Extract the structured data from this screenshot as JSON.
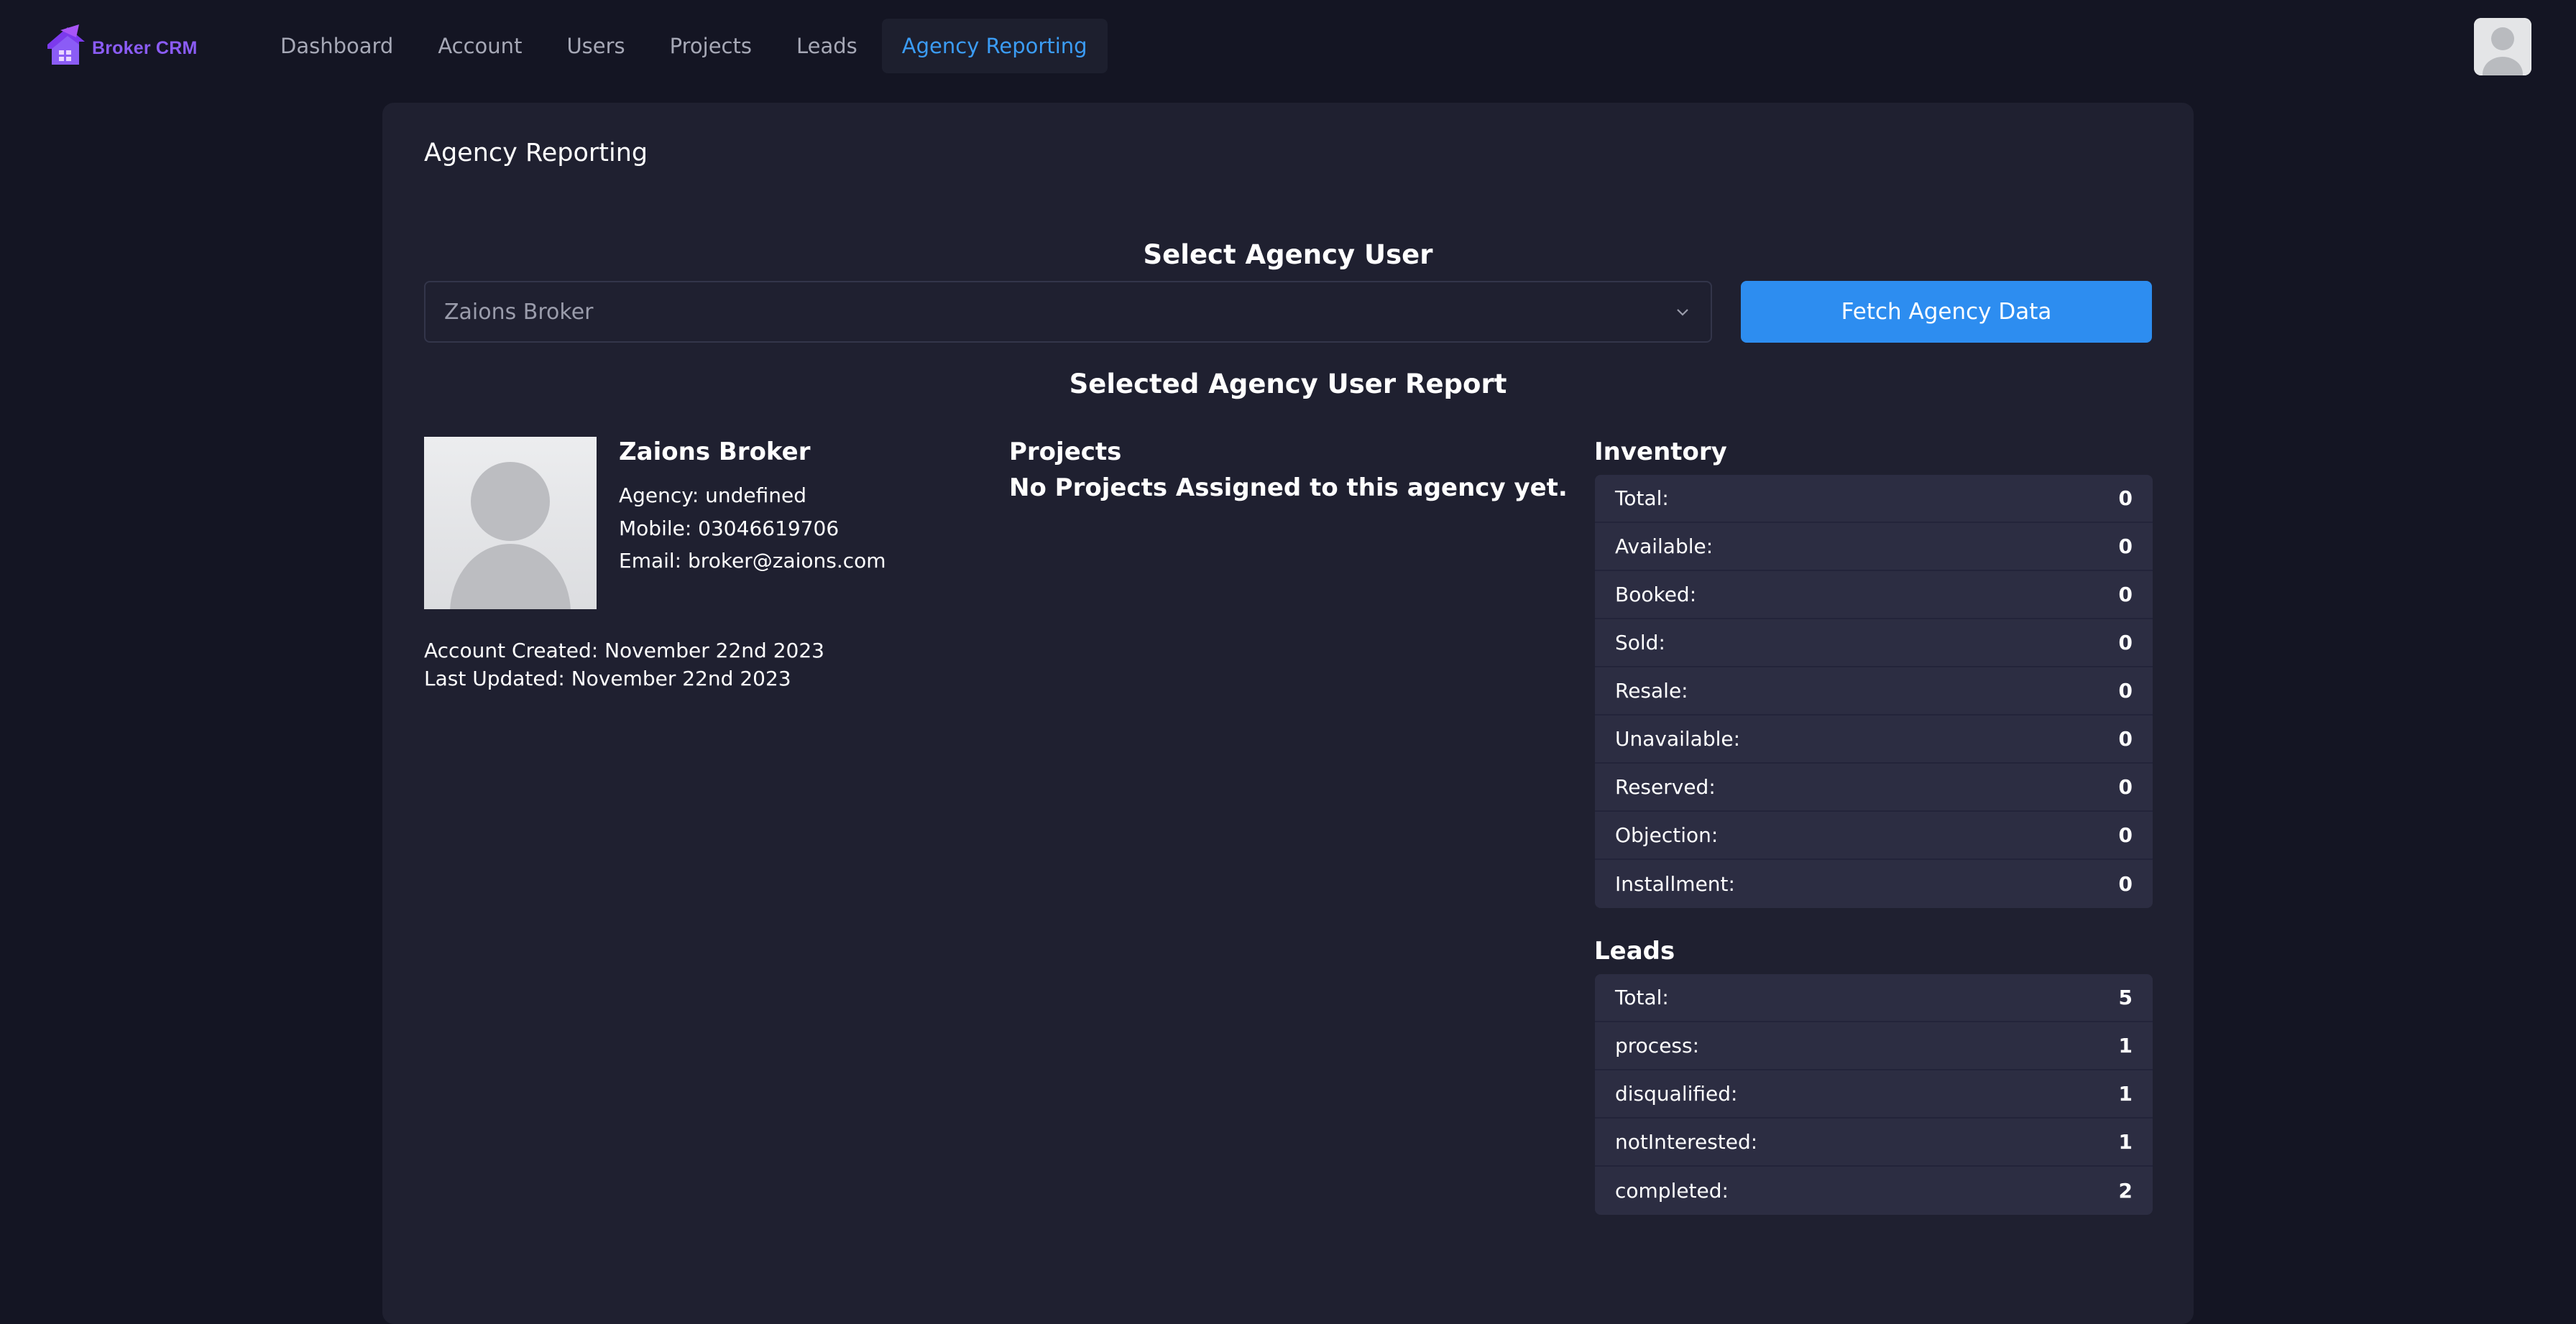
{
  "brand": {
    "name": "Broker CRM",
    "accent": "#8b5cf6"
  },
  "nav": {
    "items": [
      {
        "label": "Dashboard",
        "active": false
      },
      {
        "label": "Account",
        "active": false
      },
      {
        "label": "Users",
        "active": false
      },
      {
        "label": "Projects",
        "active": false
      },
      {
        "label": "Leads",
        "active": false
      },
      {
        "label": "Agency Reporting",
        "active": true
      }
    ],
    "active_color": "#3b9cf5"
  },
  "page": {
    "title": "Agency Reporting",
    "select_heading": "Select Agency User",
    "select_value": "Zaions Broker",
    "fetch_button": "Fetch Agency Data",
    "report_heading": "Selected Agency User Report"
  },
  "profile": {
    "name": "Zaions Broker",
    "agency": "Agency: undefined",
    "mobile": "Mobile: 03046619706",
    "email": "Email: broker@zaions.com",
    "created": "Account Created: November 22nd 2023",
    "updated": "Last Updated: November 22nd 2023"
  },
  "projects": {
    "title": "Projects",
    "empty_message": "No Projects Assigned to this agency yet."
  },
  "inventory": {
    "title": "Inventory",
    "rows": [
      {
        "label": "Total:",
        "value": "0"
      },
      {
        "label": "Available:",
        "value": "0"
      },
      {
        "label": "Booked:",
        "value": "0"
      },
      {
        "label": "Sold:",
        "value": "0"
      },
      {
        "label": "Resale:",
        "value": "0"
      },
      {
        "label": "Unavailable:",
        "value": "0"
      },
      {
        "label": "Reserved:",
        "value": "0"
      },
      {
        "label": "Objection:",
        "value": "0"
      },
      {
        "label": "Installment:",
        "value": "0"
      }
    ]
  },
  "leads": {
    "title": "Leads",
    "rows": [
      {
        "label": "Total:",
        "value": "5"
      },
      {
        "label": "process:",
        "value": "1"
      },
      {
        "label": "disqualified:",
        "value": "1"
      },
      {
        "label": "notInterested:",
        "value": "1"
      },
      {
        "label": "completed:",
        "value": "2"
      }
    ]
  },
  "icons": {
    "logo": "house-logo-icon",
    "avatar": "user-avatar-icon",
    "select_arrow": "chevron-down-icon"
  }
}
